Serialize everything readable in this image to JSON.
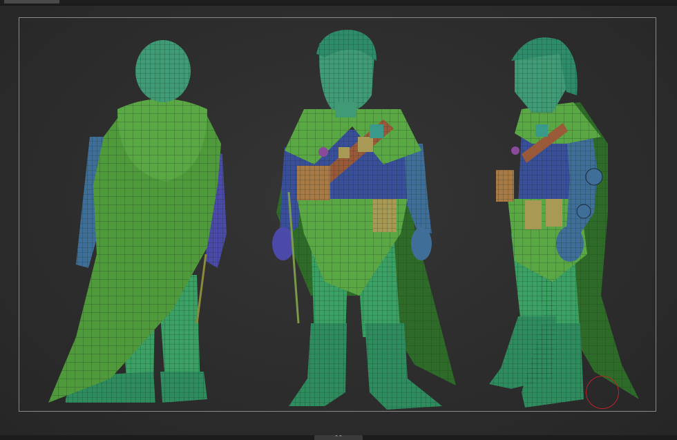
{
  "app": {
    "name": ""
  },
  "viewport": {
    "views": [
      {
        "id": "back"
      },
      {
        "id": "front"
      },
      {
        "id": "side"
      }
    ],
    "topology_overlay": "polygroups",
    "colors": {
      "cloak": "#4f9a3a",
      "cloak_dark": "#2e6b28",
      "skin": "#3f9a75",
      "metal_arm": "#3f6f98",
      "vest": "#3a4f9a",
      "belt": "#9a5a3a",
      "pouch": "#a89a55",
      "glove": "#4b4aa8",
      "legs": "#3aa063",
      "boots": "#2f8c5f",
      "gizmo": "#b8242a"
    }
  },
  "ui": {
    "navigation_handle": "⌃⌃"
  }
}
